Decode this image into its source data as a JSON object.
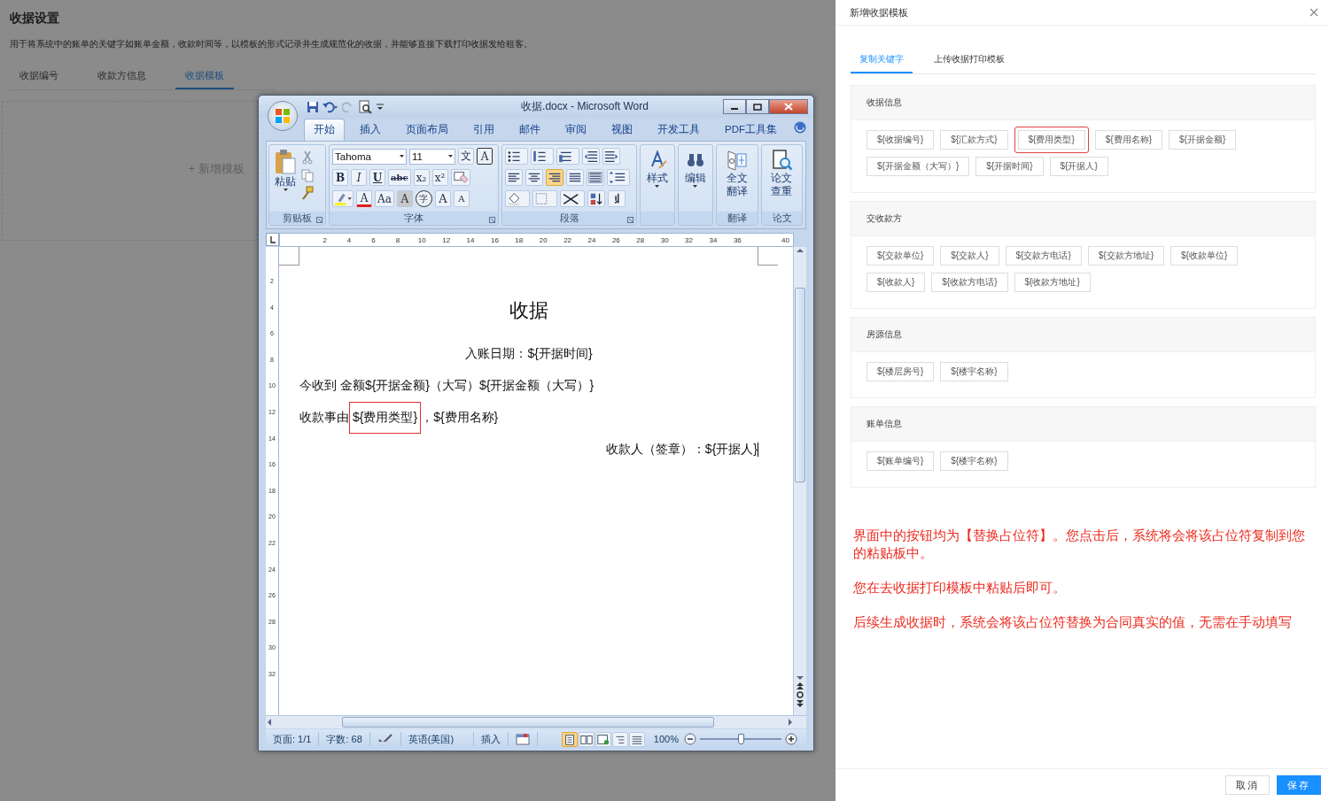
{
  "page": {
    "title": "收据设置",
    "description": "用于将系统中的账单的关键字如账单金额，收款时间等，以模板的形式记录并生成规范化的收据，并能够直接下载打印收据发给租客。",
    "tabs": [
      {
        "label": "收据编号",
        "selected": false
      },
      {
        "label": "收款方信息",
        "selected": false
      },
      {
        "label": "收据模板",
        "selected": true
      }
    ],
    "add_template": {
      "icon": "+",
      "label": "新增模板"
    }
  },
  "word": {
    "title": "收据.docx - Microsoft Word",
    "tabs": [
      {
        "label": "开始",
        "selected": true
      },
      {
        "label": "插入",
        "selected": false
      },
      {
        "label": "页面布局",
        "selected": false
      },
      {
        "label": "引用",
        "selected": false
      },
      {
        "label": "邮件",
        "selected": false
      },
      {
        "label": "审阅",
        "selected": false
      },
      {
        "label": "视图",
        "selected": false
      },
      {
        "label": "开发工具",
        "selected": false
      },
      {
        "label": "PDF工具集",
        "selected": false
      }
    ],
    "clipboard": {
      "paste": "粘贴",
      "label": "剪贴板"
    },
    "font": {
      "name": "Tahoma",
      "size": "11",
      "phonetic": "文",
      "border_char": "A",
      "label": "字体",
      "row2": [
        {
          "label": "B",
          "kind": "bold"
        },
        {
          "label": "I",
          "kind": "italic"
        },
        {
          "label": "U",
          "kind": "underline"
        },
        {
          "label": "abc",
          "kind": "strike"
        },
        {
          "label": "x₂",
          "kind": "plain"
        },
        {
          "label": "x²",
          "kind": "plain"
        }
      ],
      "row3": [
        {
          "label": "A",
          "kind": "color"
        },
        {
          "label": "Aa",
          "kind": "plain"
        },
        {
          "label": "A",
          "kind": "shade"
        },
        {
          "label": "字",
          "kind": "circle"
        },
        {
          "label": "A",
          "kind": "grow"
        },
        {
          "label": "A",
          "kind": "shrink"
        }
      ]
    },
    "paragraph": {
      "label": "段落",
      "align": [
        {
          "kind": "left",
          "selected": false
        },
        {
          "kind": "center",
          "selected": false
        },
        {
          "kind": "right",
          "selected": true
        },
        {
          "kind": "justify",
          "selected": false
        },
        {
          "kind": "distributed",
          "selected": false
        }
      ]
    },
    "styles": {
      "button": "样式"
    },
    "editing": {
      "button": "编辑"
    },
    "translate": {
      "button": "全文翻译",
      "label": "翻译"
    },
    "paper": {
      "button": "论文查重",
      "label": "论文"
    },
    "ruler": [
      "2",
      "4",
      "6",
      "8",
      "10",
      "12",
      "14",
      "16",
      "18",
      "20",
      "22",
      "24",
      "26",
      "28",
      "30",
      "32",
      "34",
      "36",
      "40"
    ],
    "vertical_ruler": [
      "2",
      "4",
      "6",
      "8",
      "10",
      "12",
      "14",
      "16",
      "18",
      "20",
      "22",
      "24",
      "26",
      "28",
      "30",
      "32"
    ],
    "document": {
      "title": "收据",
      "paragraphs": [
        {
          "kind": "center",
          "segments": [
            {
              "text": "入账日期：${开据时间}",
              "highlighted": false
            }
          ]
        },
        {
          "kind": "left",
          "segments": [
            {
              "text": "今收到 金额${开据金额}（大写）${开据金额（大写）}",
              "highlighted": false
            }
          ]
        },
        {
          "kind": "left",
          "segments": [
            {
              "text": "收款事由",
              "highlighted": false
            },
            {
              "text": "${费用类型}",
              "highlighted": true
            },
            {
              "text": "，${费用名称}",
              "highlighted": false
            }
          ]
        },
        {
          "kind": "right",
          "segments": [
            {
              "text": "收款人（签章）：${开据人}",
              "highlighted": false
            }
          ],
          "cursor": true
        }
      ]
    },
    "status": {
      "page": "页面: 1/1",
      "words": "字数: 68",
      "language": "英语(美国)",
      "mode": "插入",
      "views": [
        {
          "kind": "print",
          "selected": true
        },
        {
          "kind": "reading",
          "selected": false
        },
        {
          "kind": "web",
          "selected": false
        },
        {
          "kind": "outline",
          "selected": false
        },
        {
          "kind": "draft",
          "selected": false
        }
      ],
      "zoom": "100%",
      "zoom_slider": {
        "level": 0.5
      }
    }
  },
  "drawer": {
    "title": "新增收据模板",
    "tabs": [
      {
        "label": "复制关键字",
        "selected": true
      },
      {
        "label": "上传收据打印模板",
        "selected": false
      }
    ],
    "sections": [
      {
        "title": "收据信息",
        "keys": [
          {
            "label": "${收据编号}",
            "highlighted": false
          },
          {
            "label": "${汇款方式}",
            "highlighted": false
          },
          {
            "label": "${费用类型}",
            "highlighted": true
          },
          {
            "label": "${费用名称}",
            "highlighted": false
          },
          {
            "label": "${开据金额}",
            "highlighted": false
          },
          {
            "label": "${开据金额（大写）}",
            "highlighted": false
          },
          {
            "label": "${开据时间}",
            "highlighted": false
          },
          {
            "label": "${开据人}",
            "highlighted": false
          }
        ]
      },
      {
        "title": "交收款方",
        "keys": [
          {
            "label": "${交款单位}",
            "highlighted": false
          },
          {
            "label": "${交款人}",
            "highlighted": false
          },
          {
            "label": "${交款方电话}",
            "highlighted": false
          },
          {
            "label": "${交款方地址}",
            "highlighted": false
          },
          {
            "label": "${收款单位}",
            "highlighted": false
          },
          {
            "label": "${收款人}",
            "highlighted": false
          },
          {
            "label": "${收款方电话}",
            "highlighted": false
          },
          {
            "label": "${收款方地址}",
            "highlighted": false
          }
        ]
      },
      {
        "title": "房源信息",
        "keys": [
          {
            "label": "${楼层房号}",
            "highlighted": false
          },
          {
            "label": "${楼宇名称}",
            "highlighted": false
          }
        ]
      },
      {
        "title": "账单信息",
        "keys": [
          {
            "label": "${账单编号}",
            "highlighted": false
          },
          {
            "label": "${楼宇名称}",
            "highlighted": false
          }
        ]
      }
    ],
    "notes": [
      "界面中的按钮均为【替换占位符】。您点击后，系统将会将该占位符复制到您的粘贴板中。",
      "您在去收据打印模板中粘贴后即可。",
      "后续生成收据时，系统会将该占位符替换为合同真实的值，无需在手动填写"
    ],
    "buttons": [
      {
        "label": "取消",
        "kind": "default"
      },
      {
        "label": "保存",
        "kind": "primary"
      }
    ]
  }
}
